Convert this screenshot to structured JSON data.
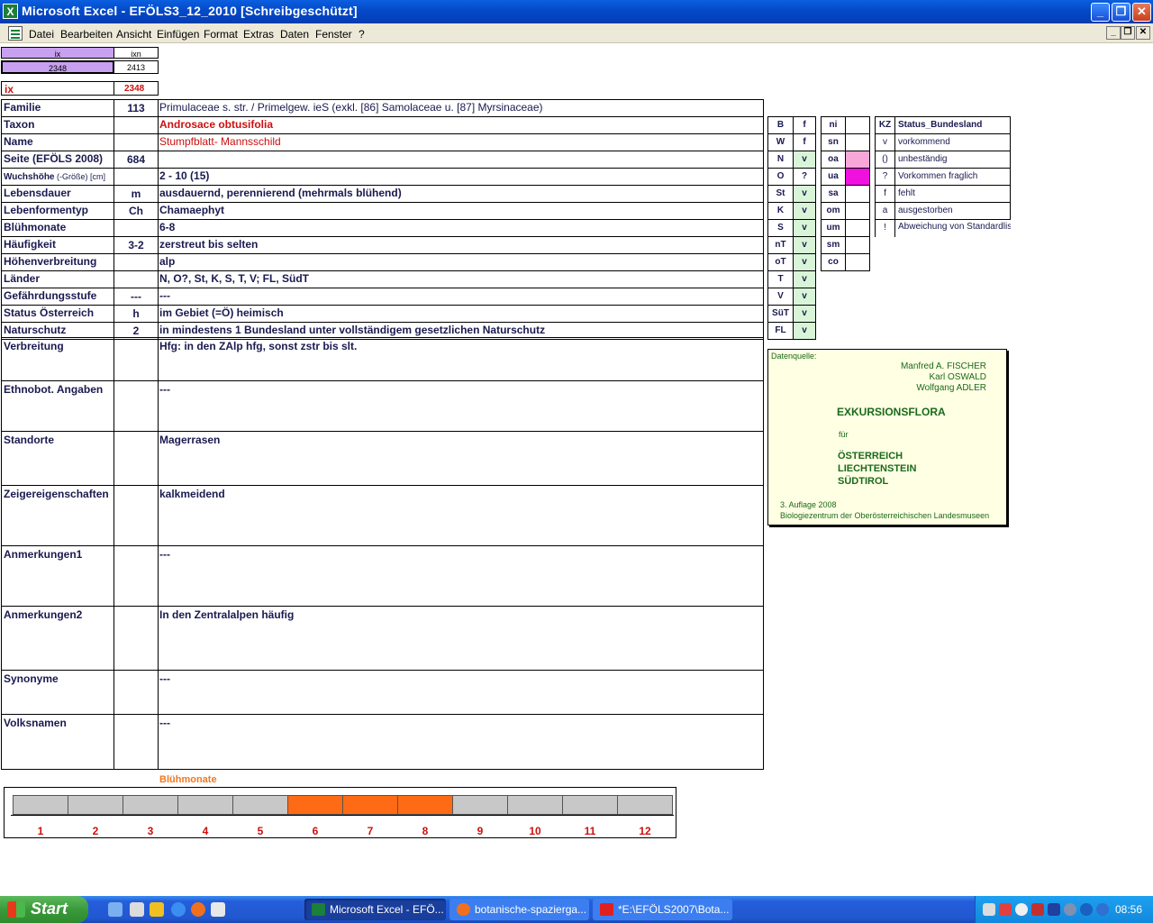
{
  "window": {
    "title": "Microsoft Excel - EFÖLS3_12_2010  [Schreibgeschützt]",
    "app_icon": "X",
    "minimize": "_",
    "restore": "❐",
    "close": "✕"
  },
  "menu": {
    "items": [
      "Datei",
      "Bearbeiten",
      "Ansicht",
      "Einfügen",
      "Format",
      "Extras",
      "Daten",
      "Fenster",
      "?"
    ],
    "mdi_min": "_",
    "mdi_restore": "❐",
    "mdi_close": "✕"
  },
  "index": {
    "ix_label": "ix",
    "ixn_label": "ixn",
    "ix_value": "2348",
    "ixn_value": "2413",
    "ix_red_label": "ix",
    "ix_red_value": "2348"
  },
  "rows": [
    {
      "label": "Familie",
      "code": "113",
      "value": "Primulaceae s. str.  /  Primelgew. ieS (exkl. [86] Samolaceae u. [87] Myrsinaceae)"
    },
    {
      "label": "Taxon",
      "code": "",
      "value": "Androsace obtusifolia"
    },
    {
      "label": "Name",
      "code": "",
      "value": "Stumpfblatt- Mannsschild"
    },
    {
      "label": "Seite (EFÖLS 2008)",
      "code": "684",
      "value": ""
    },
    {
      "label_main": "Wuchshöhe",
      "label_sub": " (-Größe) [cm]",
      "code": "",
      "value": " 2 - 10 (15)"
    },
    {
      "label": "Lebensdauer",
      "code": "m",
      "value": "ausdauernd, perennierend (mehrmals blühend)"
    },
    {
      "label": "Lebenformentyp",
      "code": "Ch",
      "value": "Chamaephyt"
    },
    {
      "label": "Blühmonate",
      "code": "",
      "value": " 6-8"
    },
    {
      "label": "Häufigkeit",
      "code": "3-2",
      "value": "zerstreut bis selten"
    },
    {
      "label": "Höhenverbreitung",
      "code": "",
      "value": "alp"
    },
    {
      "label": "Länder",
      "code": "",
      "value": "N, O?, St, K, S, T, V; FL, SüdT"
    },
    {
      "label": "Gefährdungsstufe",
      "code": "---",
      "value": "   ---"
    },
    {
      "label": "Status Österreich",
      "code": "h",
      "value": "im Gebiet (=Ö) heimisch"
    },
    {
      "label": "Naturschutz",
      "code": "2",
      "value": "in mindestens 1 Bundesland unter vollständigem gesetzlichen Naturschutz"
    }
  ],
  "tall_rows": [
    {
      "label": "Verbreitung",
      "value": "Hfg:  in den ZAlp hfg, sonst zstr bis slt."
    },
    {
      "label": "Ethnobot. Angaben",
      "value": "---"
    },
    {
      "label": "Standorte",
      "value": "Magerrasen"
    },
    {
      "label": "Zeigereigenschaften",
      "value": "kalkmeidend"
    },
    {
      "label": "Anmerkungen1",
      "value": "---"
    },
    {
      "label": "Anmerkungen2",
      "value": "In den Zentralalpen  häufig"
    },
    {
      "label": "Synonyme",
      "value": "---"
    },
    {
      "label": "Volksnamen",
      "value": "---"
    }
  ],
  "states": [
    {
      "code": "B",
      "status": "f"
    },
    {
      "code": "W",
      "status": "f"
    },
    {
      "code": "N",
      "status": "v"
    },
    {
      "code": "O",
      "status": "?"
    },
    {
      "code": "St",
      "status": "v"
    },
    {
      "code": "K",
      "status": "v"
    },
    {
      "code": "S",
      "status": "v"
    },
    {
      "code": "nT",
      "status": "v"
    },
    {
      "code": "oT",
      "status": "v"
    },
    {
      "code": "T",
      "status": "v"
    },
    {
      "code": "V",
      "status": "v"
    },
    {
      "code": "SüT",
      "status": "v"
    },
    {
      "code": "FL",
      "status": "v"
    }
  ],
  "regions": [
    {
      "code": "ni",
      "color": ""
    },
    {
      "code": "sn",
      "color": ""
    },
    {
      "code": "oa",
      "color": "#f7a8d8"
    },
    {
      "code": "ua",
      "color": "#f010e0"
    },
    {
      "code": "sa",
      "color": ""
    },
    {
      "code": "om",
      "color": ""
    },
    {
      "code": "um",
      "color": ""
    },
    {
      "code": "sm",
      "color": ""
    },
    {
      "code": "co",
      "color": ""
    }
  ],
  "legend": {
    "kz_header": "KZ",
    "title_header": "Status_Bundesland",
    "items": [
      {
        "kz": "v",
        "text": "vorkommend"
      },
      {
        "kz": "()",
        "text": "unbeständig"
      },
      {
        "kz": "?",
        "text": "Vorkommen fraglich"
      },
      {
        "kz": "f",
        "text": "fehlt"
      },
      {
        "kz": "a",
        "text": "ausgestorben"
      },
      {
        "kz": "!",
        "text": "Abweichung von Standardliste(?)"
      }
    ]
  },
  "source": {
    "label": "Datenquelle:",
    "authors": [
      "Manfred A. FISCHER",
      "Karl OSWALD",
      "Wolfgang ADLER"
    ],
    "book": "EXKURSIONSFLORA",
    "fuer": "für",
    "countries": [
      "ÖSTERREICH",
      "LIECHTENSTEIN",
      "SÜDTIROL"
    ],
    "edition": "3. Auflage 2008",
    "publisher": "Biologiezentrum der Oberösterreichischen Landesmuseen"
  },
  "bloom": {
    "title": "Blühmonate",
    "months": [
      "1",
      "2",
      "3",
      "4",
      "5",
      "6",
      "7",
      "8",
      "9",
      "10",
      "11",
      "12"
    ],
    "active": [
      6,
      7,
      8
    ],
    "active_color": "#ff6a14",
    "inactive_color": "#c8c8c8"
  },
  "taskbar": {
    "start": "Start",
    "tasks": [
      "Microsoft Excel - EFÖ...",
      "botanische-spazierga...",
      "*E:\\EFÖLS2007\\Bota..."
    ],
    "clock": "08:56"
  }
}
